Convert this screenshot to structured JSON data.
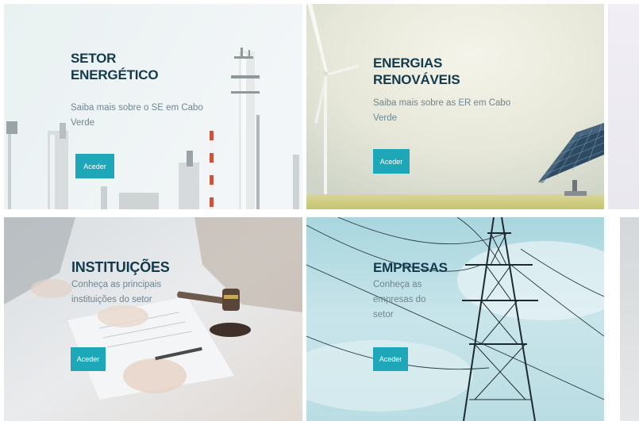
{
  "cards": [
    {
      "title_line1": "SETOR",
      "title_line2": "ENERGÉTICO",
      "description": "Saiba mais sobre o SE em Cabo Verde",
      "button": "Aceder"
    },
    {
      "title_line1": "ENERGIAS",
      "title_line2": "RENOVÁVEIS",
      "description": "Saiba mais sobre as ER em Cabo Verde",
      "button": "Aceder"
    },
    {
      "title_line1": "INSTITUIÇÕES",
      "description": "Conheça as principais instituições do setor",
      "button": "Aceder"
    },
    {
      "title_line1": "EMPRESAS",
      "description": "Conheça as empresas do setor",
      "button": "Aceder"
    }
  ],
  "colors": {
    "accent": "#1ea7b9",
    "title": "#123a4c",
    "text": "#6f8591"
  }
}
